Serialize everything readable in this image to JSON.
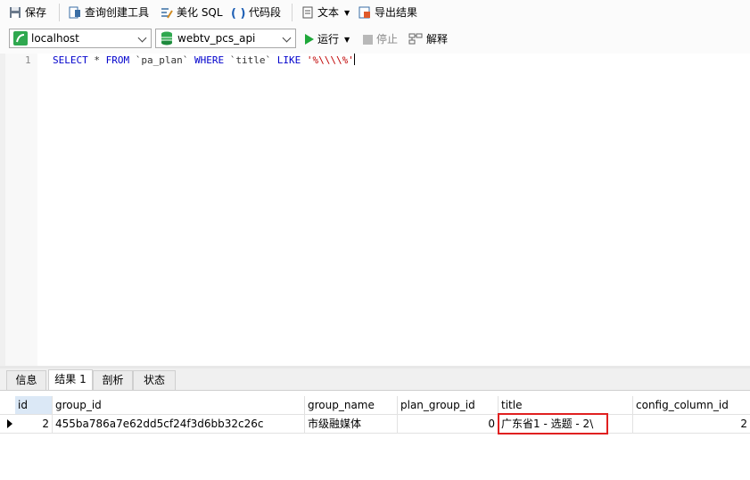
{
  "toolbar": {
    "save": "保存",
    "query_builder": "查询创建工具",
    "beautify_sql": "美化 SQL",
    "code_snippet": "代码段",
    "text": "文本",
    "export_results": "导出结果"
  },
  "toolbar2": {
    "connection": "localhost",
    "database": "webtv_pcs_api",
    "run": "运行",
    "stop": "停止",
    "explain": "解释"
  },
  "editor": {
    "line_number": "1",
    "tokens": {
      "select": "SELECT",
      "star": " * ",
      "from": "FROM",
      "table": " `pa_plan` ",
      "where": "WHERE",
      "column": " `title` ",
      "like": "LIKE",
      "space": " ",
      "pattern": "'%\\\\\\\\%'"
    }
  },
  "tabs": [
    "信息",
    "结果 1",
    "剖析",
    "状态"
  ],
  "grid": {
    "columns": [
      "id",
      "group_id",
      "group_name",
      "plan_group_id",
      "title",
      "config_column_id"
    ],
    "rows": [
      {
        "id": "2",
        "group_id": "455ba786a7e62dd5cf24f3d6bb32c26c",
        "group_name": "市级融媒体",
        "plan_group_id": "0",
        "title": "广东省1 - 选题 - 2\\",
        "config_column_id": "2"
      }
    ]
  },
  "colors": {
    "keyword": "#0000cc",
    "string": "#c00000",
    "highlight_border": "#e02020",
    "selected_header": "#dbe8f6"
  }
}
